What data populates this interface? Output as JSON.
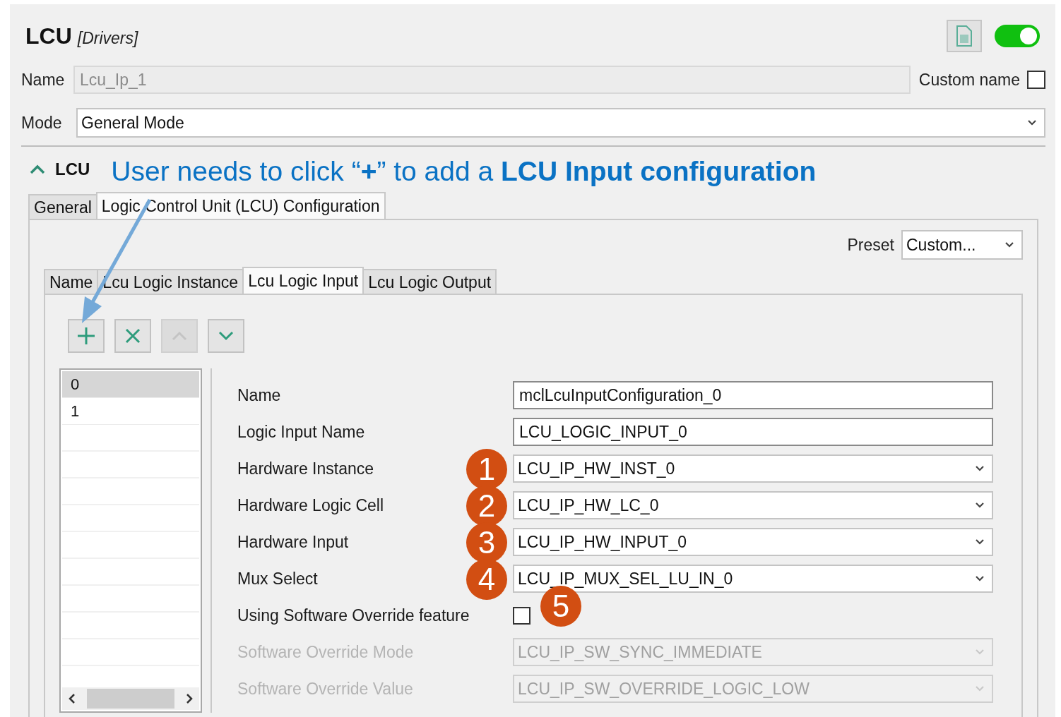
{
  "header": {
    "title": "LCU",
    "subtitle": "[Drivers]",
    "enabled": true
  },
  "name_field": {
    "label": "Name",
    "value": "Lcu_Ip_1",
    "disabled": true
  },
  "custom_name": {
    "label": "Custom name",
    "checked": false
  },
  "mode": {
    "label": "Mode",
    "value": "General Mode"
  },
  "section": {
    "title": "LCU",
    "expanded": true
  },
  "annotation": "User needs to click “**+**” to add a **LCU Input configuration**",
  "tabs": [
    {
      "label": "General",
      "selected": false
    },
    {
      "label": "Logic Control Unit (LCU) Configuration",
      "selected": true
    }
  ],
  "preset": {
    "label": "Preset",
    "value": "Custom..."
  },
  "inner_tabs": [
    {
      "label": "Name",
      "selected": false
    },
    {
      "label": "Lcu Logic Instance",
      "selected": false
    },
    {
      "label": "Lcu Logic Input",
      "selected": true
    },
    {
      "label": "Lcu Logic Output",
      "selected": false
    }
  ],
  "toolbar": [
    {
      "kind": "add",
      "disabled": false
    },
    {
      "kind": "delete",
      "disabled": false
    },
    {
      "kind": "up",
      "disabled": true
    },
    {
      "kind": "down",
      "disabled": false
    }
  ],
  "list": {
    "items": [
      {
        "label": "0",
        "selected": true
      },
      {
        "label": "1",
        "selected": false
      }
    ]
  },
  "fields": [
    {
      "label": "Name",
      "kind": "text",
      "value": "mclLcuInputConfiguration_0",
      "disabled": false
    },
    {
      "label": "Logic Input Name",
      "kind": "text",
      "value": "LCU_LOGIC_INPUT_0",
      "disabled": false
    },
    {
      "label": "Hardware Instance",
      "kind": "combo",
      "value": "LCU_IP_HW_INST_0",
      "disabled": false,
      "badge": "1"
    },
    {
      "label": "Hardware Logic Cell",
      "kind": "combo",
      "value": "LCU_IP_HW_LC_0",
      "disabled": false,
      "badge": "2"
    },
    {
      "label": "Hardware Input",
      "kind": "combo",
      "value": "LCU_IP_HW_INPUT_0",
      "disabled": false,
      "badge": "3"
    },
    {
      "label": "Mux Select",
      "kind": "combo",
      "value": "LCU_IP_MUX_SEL_LU_IN_0",
      "disabled": false,
      "badge": "4"
    },
    {
      "label": "Using Software Override feature",
      "kind": "checkbox",
      "checked": false,
      "disabled": false,
      "badge": "5"
    },
    {
      "label": "Software Override Mode",
      "kind": "combo",
      "value": "LCU_IP_SW_SYNC_IMMEDIATE",
      "disabled": true
    },
    {
      "label": "Software Override Value",
      "kind": "combo",
      "value": "LCU_IP_SW_OVERRIDE_LOGIC_LOW",
      "disabled": true
    }
  ]
}
